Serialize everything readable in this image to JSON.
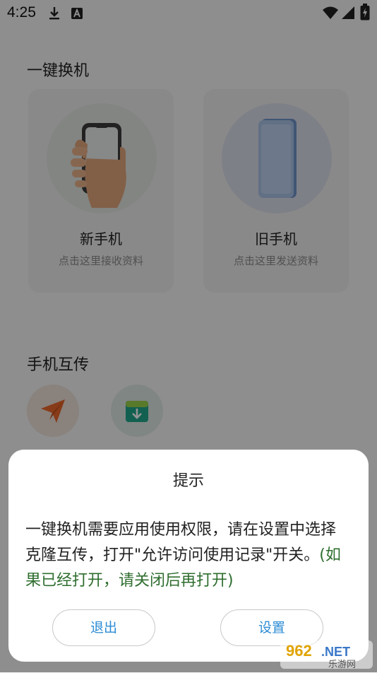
{
  "status_bar": {
    "time": "4:25"
  },
  "main": {
    "section1_title": "一键换机",
    "new_phone": {
      "title": "新手机",
      "subtitle": "点击这里接收资料"
    },
    "old_phone": {
      "title": "旧手机",
      "subtitle": "点击这里发送资料"
    },
    "section2_title": "手机互传"
  },
  "dialog": {
    "title": "提示",
    "body": "一键换机需要应用使用权限，请在设置中选择克隆互传，打开\"允许访问使用记录\"开关。",
    "hint": "(如果已经打开，请关闭后再打开)",
    "exit_label": "退出",
    "settings_label": "设置"
  },
  "watermark": {
    "brand": "962.NET",
    "subtitle": "乐游网"
  },
  "colors": {
    "accent": "#2c8cd4",
    "hint_green": "#2f6e2f",
    "send_orange": "#e8662a",
    "download_green": "#1fa58a"
  }
}
